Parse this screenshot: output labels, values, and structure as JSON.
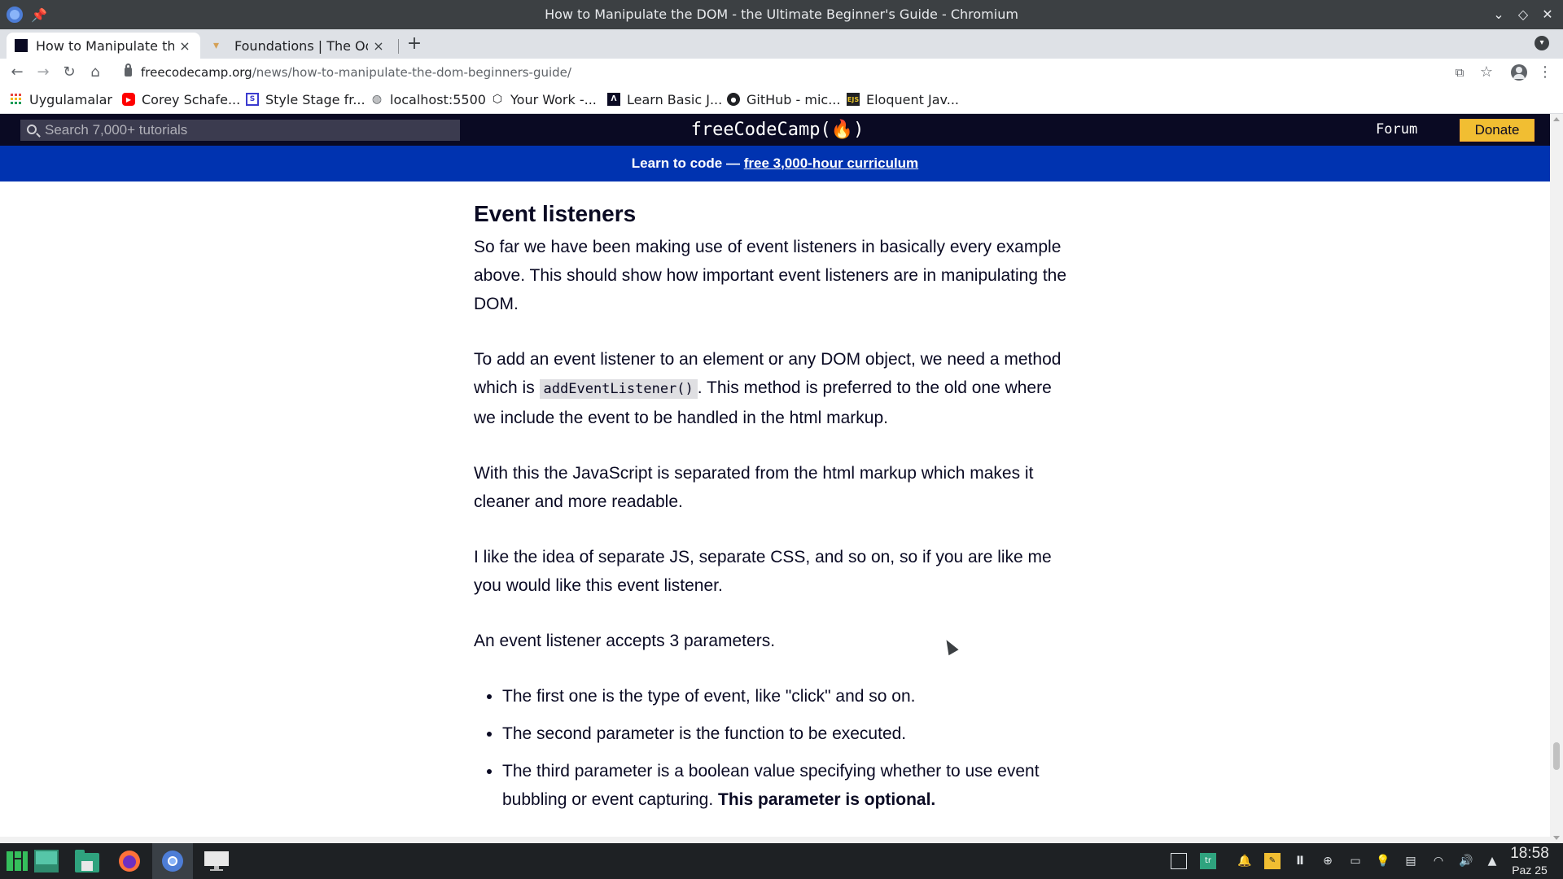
{
  "window": {
    "title": "How to Manipulate the DOM - the Ultimate Beginner's Guide - Chromium",
    "pin_icon": "pin-icon",
    "controls": [
      "minimize-icon",
      "maximize-icon",
      "close-icon"
    ]
  },
  "tabs": [
    {
      "label": "How to Manipulate the DOM - the Ultimate Beginner's Guide",
      "close": "×",
      "active": true
    },
    {
      "label": "Foundations | The Odin Project",
      "close": "×",
      "active": false
    }
  ],
  "new_tab": "+",
  "toolbar": {
    "back": "←",
    "forward": "→",
    "reload": "↻",
    "home": "⌂",
    "url_domain": "freecodecamp.org",
    "url_path": "/news/how-to-manipulate-the-dom-beginners-guide/",
    "translate": "⧉",
    "star": "☆",
    "menu": "⋮"
  },
  "bookmarks": [
    {
      "label": "Uygulamalar",
      "icon": "apps-grid-icon",
      "color": "#e8453c"
    },
    {
      "label": "Corey Schafe...",
      "icon": "youtube-icon",
      "color": "#ff0000"
    },
    {
      "label": "Style Stage fr...",
      "icon": "stylestage-icon",
      "color": "#3b3bcf"
    },
    {
      "label": "localhost:5500",
      "icon": "globe-icon",
      "color": "#5f6368"
    },
    {
      "label": "Your Work -...",
      "icon": "codepen-icon",
      "color": "#202124"
    },
    {
      "label": "Learn Basic J...",
      "icon": "freecodecamp-icon",
      "color": "#0a0a23"
    },
    {
      "label": "GitHub - mic...",
      "icon": "github-icon",
      "color": "#202124"
    },
    {
      "label": "Eloquent Jav...",
      "icon": "ejs-icon",
      "color": "#e6c229"
    }
  ],
  "fcc": {
    "search_placeholder": "Search 7,000+ tutorials",
    "logo": "freeCodeCamp(🔥)",
    "forum": "Forum",
    "donate": "Donate",
    "banner_text": "Learn to code — ",
    "banner_link": "free 3,000-hour curriculum"
  },
  "article": {
    "heading": "Event listeners",
    "p1": "So far we have been making use of event listeners in basically every example above. This should show how important event listeners are in manipulating the DOM.",
    "p2_before": "To add an event listener to an element or any DOM object, we need a method which is ",
    "p2_code": "addEventListener()",
    "p2_after": ". This method is preferred to the old one where we include the event to be handled in the html markup.",
    "p3": "With this the JavaScript is separated from the html markup which makes it cleaner and more readable.",
    "p4": "I like the idea of separate JS, separate CSS, and so on, so if you are like me you would like this event listener.",
    "p5": "An event listener accepts 3 parameters.",
    "list": [
      "The first one is the type of event, like \"click\" and so on.",
      "The second parameter is the function to be executed."
    ],
    "list3_text": "The third parameter is a boolean value specifying whether to use event bubbling or event capturing. ",
    "list3_bold": "This parameter is optional."
  },
  "taskbar": {
    "apps": [
      "manjaro-menu-icon",
      "desktop-icon",
      "file-manager-icon",
      "firefox-icon",
      "chromium-icon",
      "screen-icon"
    ],
    "tray": [
      "window-icon",
      "keyboard-layout-icon",
      "notification-bell-icon",
      "sticky-note-icon",
      "ide-icon",
      "update-icon",
      "terminal-icon",
      "lightbulb-icon",
      "clipboard-icon",
      "wifi-icon",
      "volume-icon",
      "tray-expand-icon"
    ],
    "time": "18:58",
    "date": "Paz 25"
  },
  "colors": {
    "fcc_dark": "#0a0a23",
    "fcc_banner": "#0033b0",
    "donate_yellow": "#f1be32"
  }
}
